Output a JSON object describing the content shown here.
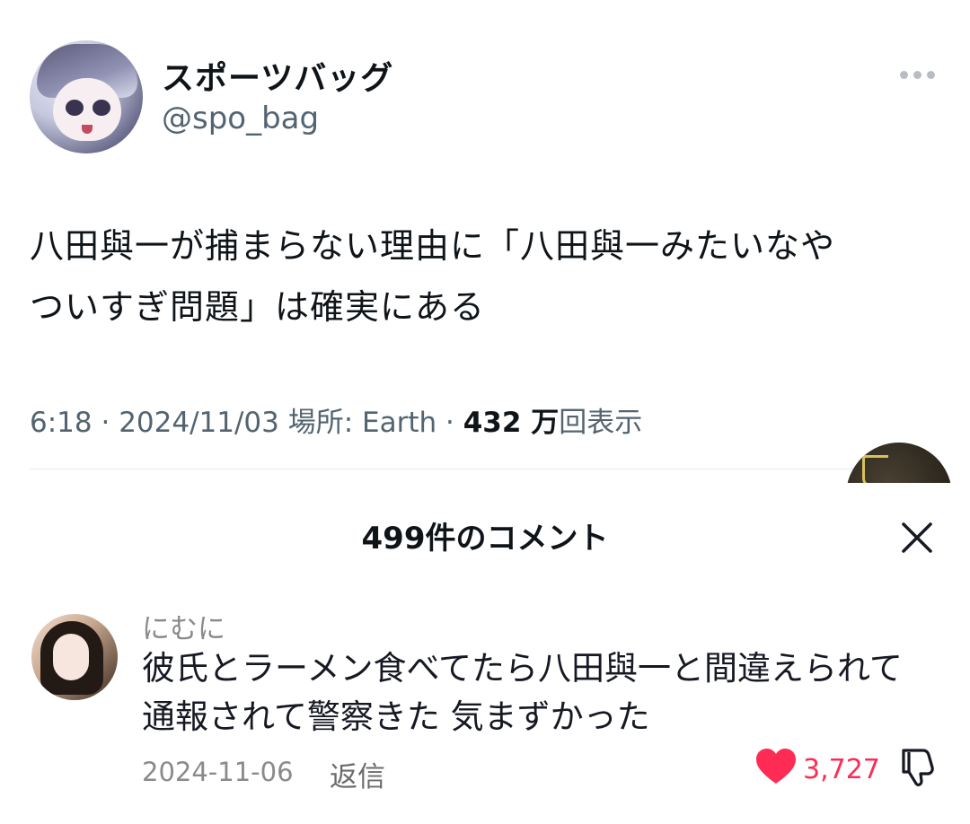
{
  "tweet": {
    "display_name": "スポーツバッグ",
    "handle": "@spo_bag",
    "text_line1": "八田與一が捕まらない理由に「八田與一みたいなや",
    "text_line2": "ついすぎ問題」は確実にある",
    "time": "6:18",
    "date": "2024/11/03",
    "location_label": "場所: Earth",
    "views_count": "432 万",
    "views_label": "回表示"
  },
  "comments_sheet": {
    "title": "499件のコメント"
  },
  "comment": {
    "username": "にむに",
    "text_line1": "彼氏とラーメン食べてたら八田與一と間違えられて",
    "text_line2": "通報されて警察きた 気まずかった",
    "date": "2024-11-06",
    "reply_label": "返信",
    "like_count": "3,727"
  },
  "icons": {
    "more": "more-dots-icon",
    "close": "close-icon",
    "like": "heart-icon",
    "dislike": "thumbs-down-icon"
  },
  "colors": {
    "like_accent": "#fe2c55",
    "secondary_text": "#536471"
  }
}
